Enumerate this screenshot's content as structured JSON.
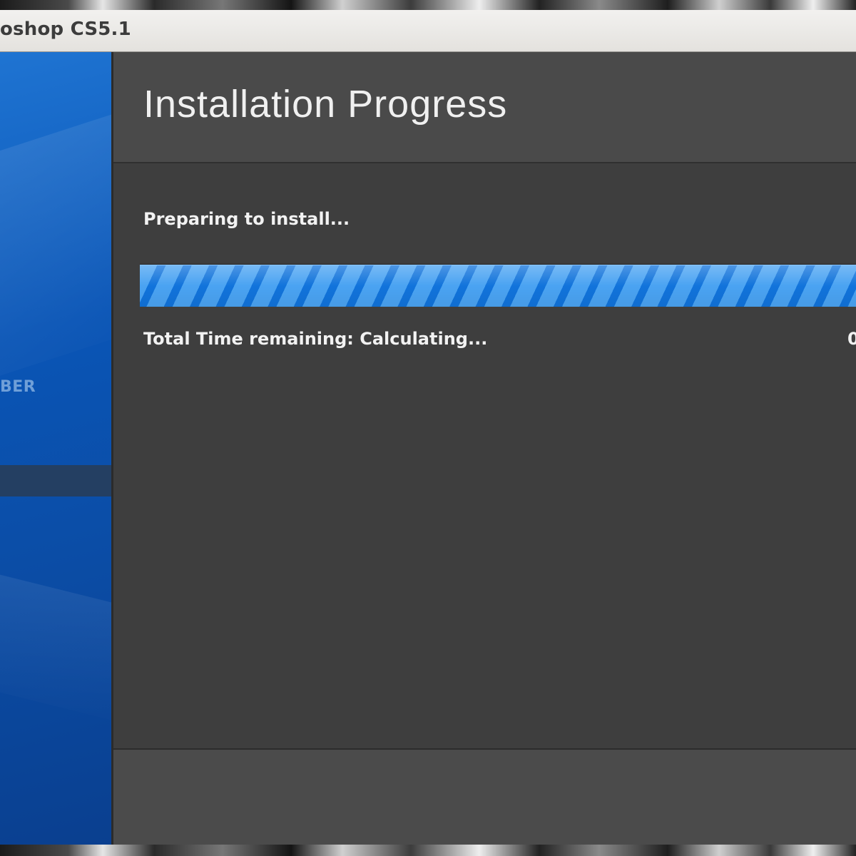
{
  "window": {
    "title": "oshop CS5.1"
  },
  "sidebar": {
    "step_label": "BER"
  },
  "header": {
    "title": "Installation Progress"
  },
  "status": {
    "message": "Preparing to install...",
    "time_remaining": "Total Time remaining: Calculating...",
    "percent_text": "0",
    "progress": 1.0
  },
  "colors": {
    "sidebar_blue": "#0a55b6",
    "progress_blue": "#4aa3f2",
    "panel_dark": "#3e3e3e"
  }
}
